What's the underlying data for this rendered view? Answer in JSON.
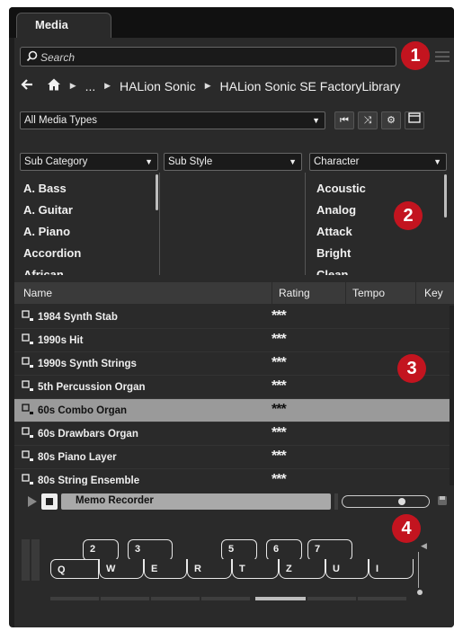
{
  "tab": {
    "label": "Media"
  },
  "search": {
    "placeholder": "Search"
  },
  "breadcrumb": {
    "ellipsis": "...",
    "items": [
      "HALion Sonic",
      "HALion Sonic SE FactoryLibrary"
    ]
  },
  "media_types": {
    "value": "All Media Types"
  },
  "filters": {
    "sub_category": {
      "label": "Sub Category",
      "items": [
        "A. Bass",
        "A. Guitar",
        "A. Piano",
        "Accordion",
        "African"
      ]
    },
    "sub_style": {
      "label": "Sub Style",
      "items": []
    },
    "character": {
      "label": "Character",
      "items": [
        "Acoustic",
        "Analog",
        "Attack",
        "Bright",
        "Clean"
      ]
    }
  },
  "results": {
    "columns": {
      "name": "Name",
      "rating": "Rating",
      "tempo": "Tempo",
      "key": "Key"
    },
    "rows": [
      {
        "name": "1984 Synth Stab",
        "rating": "***"
      },
      {
        "name": "1990s Hit",
        "rating": "***"
      },
      {
        "name": "1990s Synth Strings",
        "rating": "***"
      },
      {
        "name": "5th Percussion Organ",
        "rating": "***"
      },
      {
        "name": "60s Combo Organ",
        "rating": "***",
        "selected": true
      },
      {
        "name": "60s Drawbars Organ",
        "rating": "***"
      },
      {
        "name": "80s Piano Layer",
        "rating": "***"
      },
      {
        "name": "80s String Ensemble",
        "rating": "***"
      }
    ]
  },
  "transport": {
    "memo_label": "Memo Recorder",
    "level": 0.72
  },
  "keyboard": {
    "black_keys": [
      "2",
      "3",
      "5",
      "6",
      "7"
    ],
    "white_keys": [
      "Q",
      "W",
      "E",
      "R",
      "T",
      "Z",
      "U",
      "I"
    ]
  },
  "callouts": [
    "1",
    "2",
    "3",
    "4"
  ],
  "colors": {
    "callout": "#c3141f",
    "panel": "#2a2a2a",
    "selected_row": "#9a9a9a"
  },
  "icons": [
    "search-icon",
    "list-view-icon",
    "back-arrow-icon",
    "home-icon",
    "previous-icon",
    "shuffle-icon",
    "settings-icon",
    "preview-panel-icon",
    "play-icon",
    "stop-icon",
    "save-icon"
  ]
}
